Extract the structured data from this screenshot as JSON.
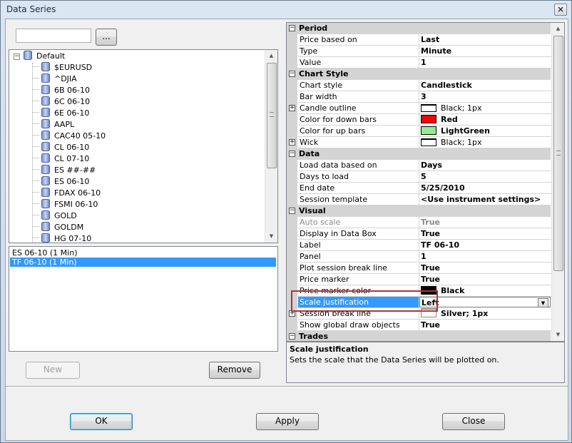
{
  "window": {
    "title": "Data Series",
    "close_glyph": "×"
  },
  "search": {
    "value": "",
    "browse_label": "..."
  },
  "tree": {
    "root_label": "Default",
    "root_expander": "−",
    "items": [
      "$EURUSD",
      "^DJIA",
      "6B 06-10",
      "6C 06-10",
      "6E 06-10",
      "AAPL",
      "CAC40 05-10",
      "CL 06-10",
      "CL 07-10",
      "ES ##-##",
      "ES 06-10",
      "FDAX 06-10",
      "FSMI 06-10",
      "GOLD",
      "GOLDM",
      "HG 07-10"
    ]
  },
  "series_list": {
    "items": [
      {
        "label": "ES 06-10 (1 Min)",
        "selected": false
      },
      {
        "label": "TF 06-10 (1 Min)",
        "selected": true
      }
    ]
  },
  "buttons": {
    "new": "New",
    "remove": "Remove",
    "ok": "OK",
    "apply": "Apply",
    "close": "Close"
  },
  "properties": {
    "period": {
      "title": "Period",
      "rows": [
        {
          "name": "Price based on",
          "value": "Last"
        },
        {
          "name": "Type",
          "value": "Minute"
        },
        {
          "name": "Value",
          "value": "1"
        }
      ]
    },
    "chart_style": {
      "title": "Chart Style",
      "chart_style": {
        "name": "Chart style",
        "value": "Candlestick"
      },
      "bar_width": {
        "name": "Bar width",
        "value": "3"
      },
      "candle_outline": {
        "name": "Candle outline",
        "value": "Black; 1px",
        "color": "#ffffff"
      },
      "down_bars": {
        "name": "Color for down bars",
        "value": "Red",
        "color": "#ff0000"
      },
      "up_bars": {
        "name": "Color for up bars",
        "value": "LightGreen",
        "color": "#90ee90"
      },
      "wick": {
        "name": "Wick",
        "value": "Black; 1px",
        "color": "#ffffff"
      }
    },
    "data": {
      "title": "Data",
      "rows": [
        {
          "name": "Load data based on",
          "value": "Days"
        },
        {
          "name": "Days to load",
          "value": "5"
        },
        {
          "name": "End date",
          "value": "5/25/2010"
        },
        {
          "name": "Session template",
          "value": "<Use instrument settings>"
        }
      ]
    },
    "visual": {
      "title": "Visual",
      "auto_scale": {
        "name": "Auto scale",
        "value": "True"
      },
      "display_in_data_box": {
        "name": "Display in Data Box",
        "value": "True"
      },
      "label": {
        "name": "Label",
        "value": "TF 06-10"
      },
      "panel": {
        "name": "Panel",
        "value": "1"
      },
      "plot_session_break_line": {
        "name": "Plot session break line",
        "value": "True"
      },
      "price_marker": {
        "name": "Price marker",
        "value": "True"
      },
      "price_marker_color": {
        "name": "Price marker color",
        "value": "Black",
        "color": "#000000"
      },
      "scale_justification": {
        "name": "Scale justification",
        "value": "Left"
      },
      "session_break_line": {
        "name": "Session break line",
        "value": "Silver; 1px",
        "color": "#ffffff"
      },
      "show_global_draw_objects": {
        "name": "Show global draw objects",
        "value": "True"
      }
    },
    "trades": {
      "title": "Trades"
    }
  },
  "description": {
    "title": "Scale justification",
    "text": "Sets the scale that the Data Series will be plotted on."
  }
}
